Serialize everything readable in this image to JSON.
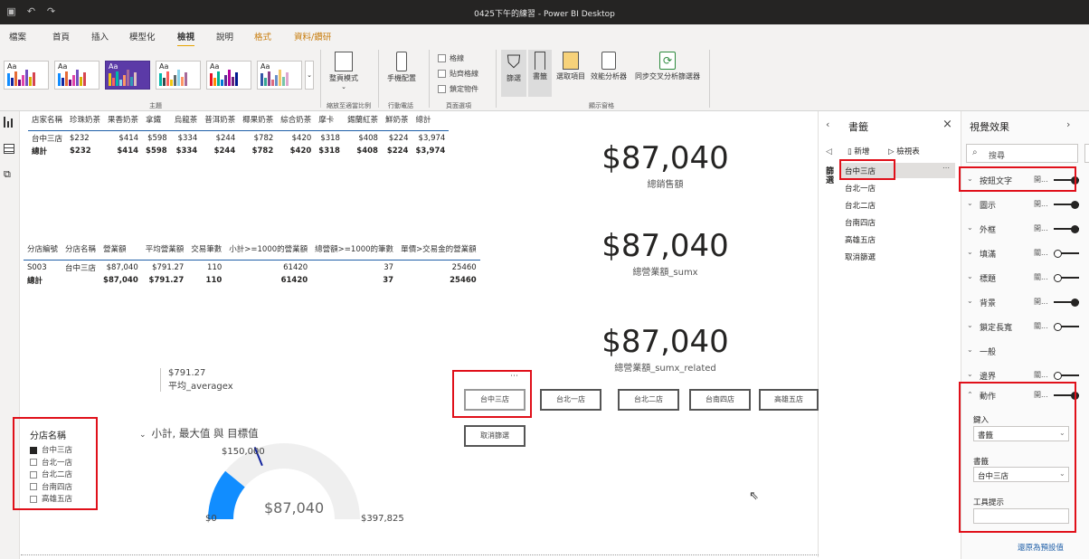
{
  "window": {
    "title": "0425下午的練習 - Power BI Desktop"
  },
  "menu": {
    "tabs": [
      "檔案",
      "首頁",
      "插入",
      "模型化",
      "檢視",
      "說明",
      "格式",
      "資料/鑽研"
    ],
    "active": "檢視"
  },
  "ribbon": {
    "themes_group": "主題",
    "page_view": {
      "label": "整頁模式",
      "group": "縮放至適當比例"
    },
    "phone": {
      "label": "手機配置",
      "group": "行動電話"
    },
    "page_options": {
      "items": [
        "格線",
        "貼齊格線",
        "鎖定物件"
      ],
      "group": "頁面選項"
    },
    "show_panes": {
      "items": [
        "篩選",
        "書籤",
        "選取項目",
        "效能分析器",
        "同步交叉分析篩選器"
      ],
      "group": "顯示窗格"
    }
  },
  "table1": {
    "headers": [
      "店家名稱",
      "珍珠奶茶",
      "果香奶茶",
      "拿鐵",
      "烏龍茶",
      "普洱奶茶",
      "椰果奶茶",
      "綜合奶茶",
      "摩卡",
      "錫蘭紅茶",
      "鮮奶茶",
      "總計"
    ],
    "rows": [
      [
        "台中三店",
        "$232",
        "$414",
        "$598",
        "$334",
        "$244",
        "$782",
        "$420",
        "$318",
        "$408",
        "$224",
        "$3,974"
      ],
      [
        "總計",
        "$232",
        "$414",
        "$598",
        "$334",
        "$244",
        "$782",
        "$420",
        "$318",
        "$408",
        "$224",
        "$3,974"
      ]
    ]
  },
  "table2": {
    "headers": [
      "分店編號",
      "分店名稱",
      "營業額",
      "平均營業額",
      "交易筆數",
      "小計>=1000的營業額",
      "總營額>=1000的筆數",
      "單價>交易金的營業額"
    ],
    "rows": [
      [
        "S003",
        "台中三店",
        "$87,040",
        "$791.27",
        "110",
        "61420",
        "37",
        "25460"
      ],
      [
        "總計",
        "",
        "$87,040",
        "$791.27",
        "110",
        "61420",
        "37",
        "25460"
      ]
    ]
  },
  "cards": [
    {
      "value": "$87,040",
      "caption": "總銷售額"
    },
    {
      "value": "$87,040",
      "caption": "總營業額_sumx"
    },
    {
      "value": "$87,040",
      "caption": "總營業額_sumx_related"
    }
  ],
  "avg_card": {
    "value": "$791.27",
    "caption": "平均_averagex"
  },
  "slicer": {
    "title": "分店名稱",
    "items": [
      "台中三店",
      "台北一店",
      "台北二店",
      "台南四店",
      "高雄五店"
    ],
    "checked": [
      true,
      false,
      false,
      false,
      false
    ]
  },
  "gauge": {
    "title": "小計, 最大值 與 目標值",
    "value": "$87,040",
    "min": "$0",
    "max": "$397,825",
    "target": "$150,000",
    "value_num": 87040,
    "min_num": 0,
    "max_num": 397825,
    "target_num": 150000
  },
  "bookmark_buttons": [
    "台中三店",
    "台北一店",
    "台北二店",
    "台南四店",
    "高雄五店",
    "取消篩選"
  ],
  "bookmarks_pane": {
    "title": "書籤",
    "add": "新增",
    "view": "檢視表",
    "side_label": "篩選",
    "items": [
      "台中三店",
      "台北一店",
      "台北二店",
      "台南四店",
      "高雄五店",
      "取消篩選"
    ],
    "selected": "台中三店"
  },
  "visual_pane": {
    "title": "視覺效果",
    "search_placeholder": "搜尋",
    "sections": [
      {
        "name": "按鈕文字",
        "state": "開...",
        "on": true
      },
      {
        "name": "圖示",
        "state": "開...",
        "on": true
      },
      {
        "name": "外框",
        "state": "開...",
        "on": true
      },
      {
        "name": "填滿",
        "state": "關...",
        "on": false
      },
      {
        "name": "標題",
        "state": "關...",
        "on": false
      },
      {
        "name": "背景",
        "state": "開...",
        "on": true
      },
      {
        "name": "鎖定長寬",
        "state": "關...",
        "on": false
      },
      {
        "name": "一般",
        "state": "",
        "on": null
      },
      {
        "name": "邊界",
        "state": "關...",
        "on": false
      }
    ],
    "action": {
      "name": "動作",
      "state": "開...",
      "type_label": "鍵入",
      "type_value": "書籤",
      "bookmark_label": "書籤",
      "bookmark_value": "台中三店",
      "tooltip_label": "工具提示",
      "tooltip_value": ""
    },
    "reset": "還原為預設值"
  },
  "colors": {
    "accent": "#e5a300",
    "highlight": "#e0101a",
    "gauge": "#118dff",
    "theme_selected": "#5b3aa7"
  }
}
